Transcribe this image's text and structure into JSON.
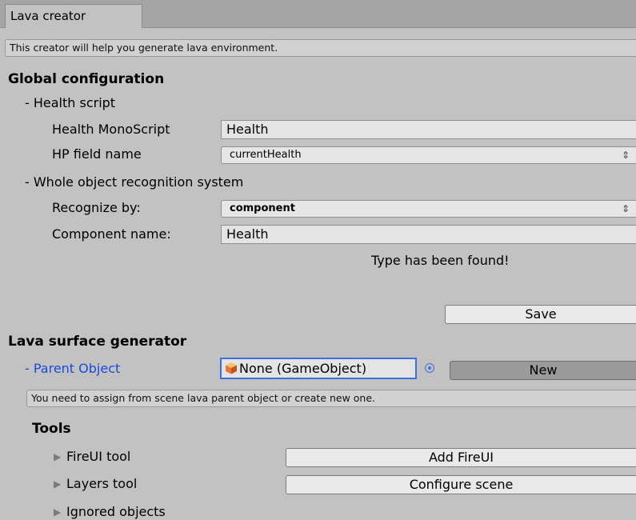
{
  "tab": {
    "title": "Lava creator"
  },
  "intro_help": "This creator will help you generate lava environment.",
  "global": {
    "heading": "Global configuration",
    "health_script": {
      "label": "- Health script",
      "monoscript_label": "Health MonoScript",
      "monoscript_value": "Health",
      "hp_field_label": "HP field name",
      "hp_field_value": "currentHealth"
    },
    "recognition": {
      "label": "- Whole object recognition system",
      "recognize_label": "Recognize by:",
      "recognize_value": "component",
      "component_label": "Component name:",
      "component_value": "Health",
      "status": "Type has been found!"
    },
    "save_label": "Save"
  },
  "surface": {
    "heading": "Lava surface generator",
    "parent_label": "- Parent Object",
    "parent_value": "None (GameObject)",
    "new_label": "New",
    "help": "You need to assign from scene lava parent object or create new one."
  },
  "tools": {
    "heading": "Tools",
    "items": [
      {
        "label": "FireUI tool",
        "button": "Add FireUI"
      },
      {
        "label": "Layers tool",
        "button": "Configure scene"
      },
      {
        "label": "Ignored objects"
      }
    ]
  },
  "icons": {
    "popup_arrows": "updown-arrows-icon",
    "foldout": "triangle-right-icon",
    "object": "gameobject-cube-icon",
    "picker": "object-picker-icon"
  },
  "colors": {
    "background": "#c2c2c2",
    "focus_blue": "#3f6ee0",
    "label_blue": "#1a4ad8"
  }
}
